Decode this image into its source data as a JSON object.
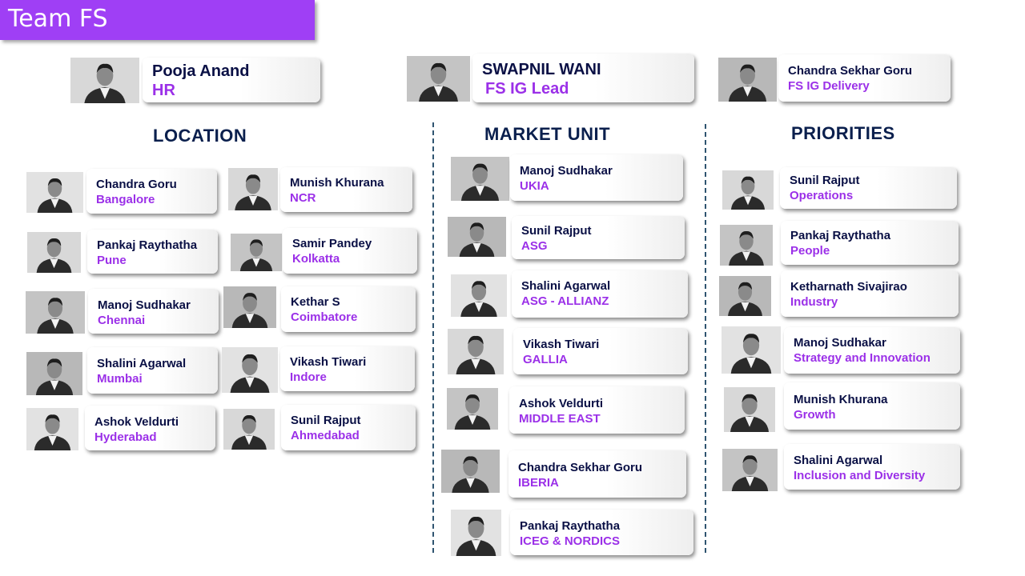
{
  "title": "Team FS",
  "leads": [
    {
      "name": "Pooja Anand",
      "role": "HR"
    },
    {
      "name": "SWAPNIL WANI",
      "role": "FS IG Lead"
    },
    {
      "name": "Chandra Sekhar Goru",
      "role": "FS IG Delivery"
    }
  ],
  "sections": {
    "location": "LOCATION",
    "market_unit": "MARKET UNIT",
    "priorities": "PRIORITIES"
  },
  "location": [
    {
      "name": "Chandra Goru",
      "role": "Bangalore"
    },
    {
      "name": "Munish Khurana",
      "role": "NCR"
    },
    {
      "name": "Pankaj Raythatha",
      "role": "Pune"
    },
    {
      "name": "Samir Pandey",
      "role": "Kolkatta"
    },
    {
      "name": "Manoj Sudhakar",
      "role": "Chennai"
    },
    {
      "name": "Kethar S",
      "role": "Coimbatore"
    },
    {
      "name": "Shalini Agarwal",
      "role": "Mumbai"
    },
    {
      "name": "Vikash Tiwari",
      "role": "Indore"
    },
    {
      "name": "Ashok Veldurti",
      "role": "Hyderabad"
    },
    {
      "name": "Sunil Rajput",
      "role": "Ahmedabad"
    }
  ],
  "market_unit": [
    {
      "name": "Manoj Sudhakar",
      "role": "UKIA"
    },
    {
      "name": "Sunil Rajput",
      "role": "ASG"
    },
    {
      "name": "Shalini Agarwal",
      "role": "ASG - ALLIANZ"
    },
    {
      "name": "Vikash Tiwari",
      "role": "GALLIA"
    },
    {
      "name": "Ashok Veldurti",
      "role": "MIDDLE EAST"
    },
    {
      "name": "Chandra Sekhar Goru",
      "role": "IBERIA"
    },
    {
      "name": "Pankaj Raythatha",
      "role": "ICEG & NORDICS"
    }
  ],
  "priorities": [
    {
      "name": "Sunil Rajput",
      "role": "Operations"
    },
    {
      "name": "Pankaj Raythatha",
      "role": "People"
    },
    {
      "name": "Ketharnath Sivajirao",
      "role": "Industry"
    },
    {
      "name": "Manoj Sudhakar",
      "role": "Strategy and Innovation"
    },
    {
      "name": "Munish Khurana",
      "role": "Growth"
    },
    {
      "name": "Shalini Agarwal",
      "role": "Inclusion and Diversity"
    }
  ]
}
